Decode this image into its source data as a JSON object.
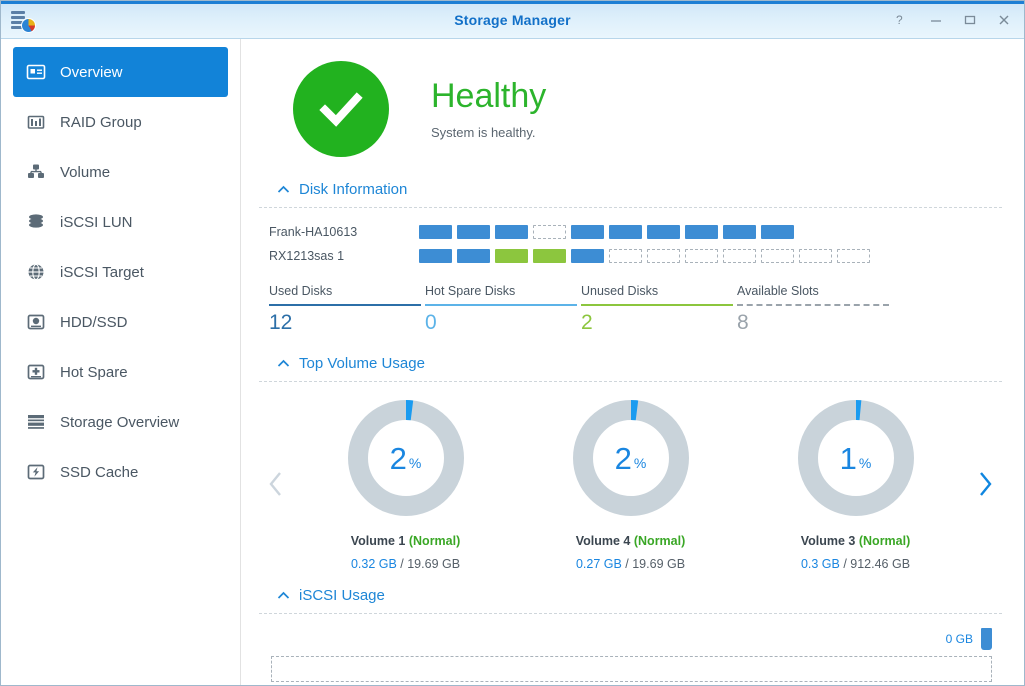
{
  "window": {
    "title": "Storage Manager",
    "app_icon": "storage-manager-icon",
    "controls": [
      {
        "name": "help-button",
        "glyph": "?"
      },
      {
        "name": "minimize-button",
        "glyph": "–"
      },
      {
        "name": "maximize-button",
        "glyph": "□"
      },
      {
        "name": "close-button",
        "glyph": "✕"
      }
    ]
  },
  "sidebar": {
    "items": [
      {
        "label": "Overview",
        "icon": "overview-icon",
        "active": true
      },
      {
        "label": "RAID Group",
        "icon": "raid-group-icon",
        "active": false
      },
      {
        "label": "Volume",
        "icon": "volume-icon",
        "active": false
      },
      {
        "label": "iSCSI LUN",
        "icon": "iscsi-lun-icon",
        "active": false
      },
      {
        "label": "iSCSI Target",
        "icon": "iscsi-target-icon",
        "active": false
      },
      {
        "label": "HDD/SSD",
        "icon": "hdd-ssd-icon",
        "active": false
      },
      {
        "label": "Hot Spare",
        "icon": "hot-spare-icon",
        "active": false
      },
      {
        "label": "Storage Overview",
        "icon": "storage-overview-icon",
        "active": false
      },
      {
        "label": "SSD Cache",
        "icon": "ssd-cache-icon",
        "active": false
      }
    ]
  },
  "health": {
    "status": "Healthy",
    "message": "System is healthy.",
    "icon": "check-circle-icon",
    "color": "#22b21f"
  },
  "disk_information": {
    "header": "Disk Information",
    "collapse_icon": "chevron-up-icon",
    "enclosures": [
      {
        "label": "Frank-HA10613",
        "slots": [
          "used",
          "used",
          "used",
          "empty",
          "used",
          "used",
          "used",
          "used",
          "used",
          "used"
        ]
      },
      {
        "label": "RX1213sas 1",
        "slots": [
          "used",
          "used",
          "unused",
          "unused",
          "used",
          "empty",
          "empty",
          "empty",
          "empty",
          "empty",
          "empty",
          "empty"
        ]
      }
    ],
    "stats": [
      {
        "label": "Used Disks",
        "value": "12",
        "color": "#2c6fa8",
        "rule_style": "solid"
      },
      {
        "label": "Hot Spare Disks",
        "value": "0",
        "color": "#5cb3e8",
        "rule_style": "solid"
      },
      {
        "label": "Unused Disks",
        "value": "2",
        "color": "#8cc63e",
        "rule_style": "solid"
      },
      {
        "label": "Available Slots",
        "value": "8",
        "color": "#9aa3ab",
        "rule_style": "dashed"
      }
    ]
  },
  "top_volume_usage": {
    "header": "Top Volume Usage",
    "collapse_icon": "chevron-up-icon",
    "prev_icon": "chevron-left-icon",
    "next_icon": "chevron-right-icon",
    "prev_enabled": false,
    "next_enabled": true,
    "volumes": [
      {
        "name": "Volume 1",
        "status": "Normal",
        "percent": 2,
        "percent_text": "2",
        "percent_symbol": "%",
        "used": "0.32 GB",
        "separator": " / ",
        "total": "19.69 GB"
      },
      {
        "name": "Volume 4",
        "status": "Normal",
        "percent": 2,
        "percent_text": "2",
        "percent_symbol": "%",
        "used": "0.27 GB",
        "separator": " / ",
        "total": "19.69 GB"
      },
      {
        "name": "Volume 3",
        "status": "Normal",
        "percent": 1,
        "percent_text": "1",
        "percent_symbol": "%",
        "used": "0.3 GB",
        "separator": " / ",
        "total": "912.46 GB"
      }
    ]
  },
  "iscsi_usage": {
    "header": "iSCSI Usage",
    "collapse_icon": "chevron-up-icon",
    "capacity_label": "0 GB"
  },
  "chart_data": {
    "type": "pie",
    "title": "Top Volume Usage",
    "charts": [
      {
        "label": "Volume 1 (Normal)",
        "percent_used": 2,
        "used_gb": 0.32,
        "total_gb": 19.69
      },
      {
        "label": "Volume 4 (Normal)",
        "percent_used": 2,
        "used_gb": 0.27,
        "total_gb": 19.69
      },
      {
        "label": "Volume 3 (Normal)",
        "percent_used": 1,
        "used_gb": 0.3,
        "total_gb": 912.46
      }
    ],
    "colors": {
      "used": "#1a9bf0",
      "free": "#c9d3da"
    }
  }
}
